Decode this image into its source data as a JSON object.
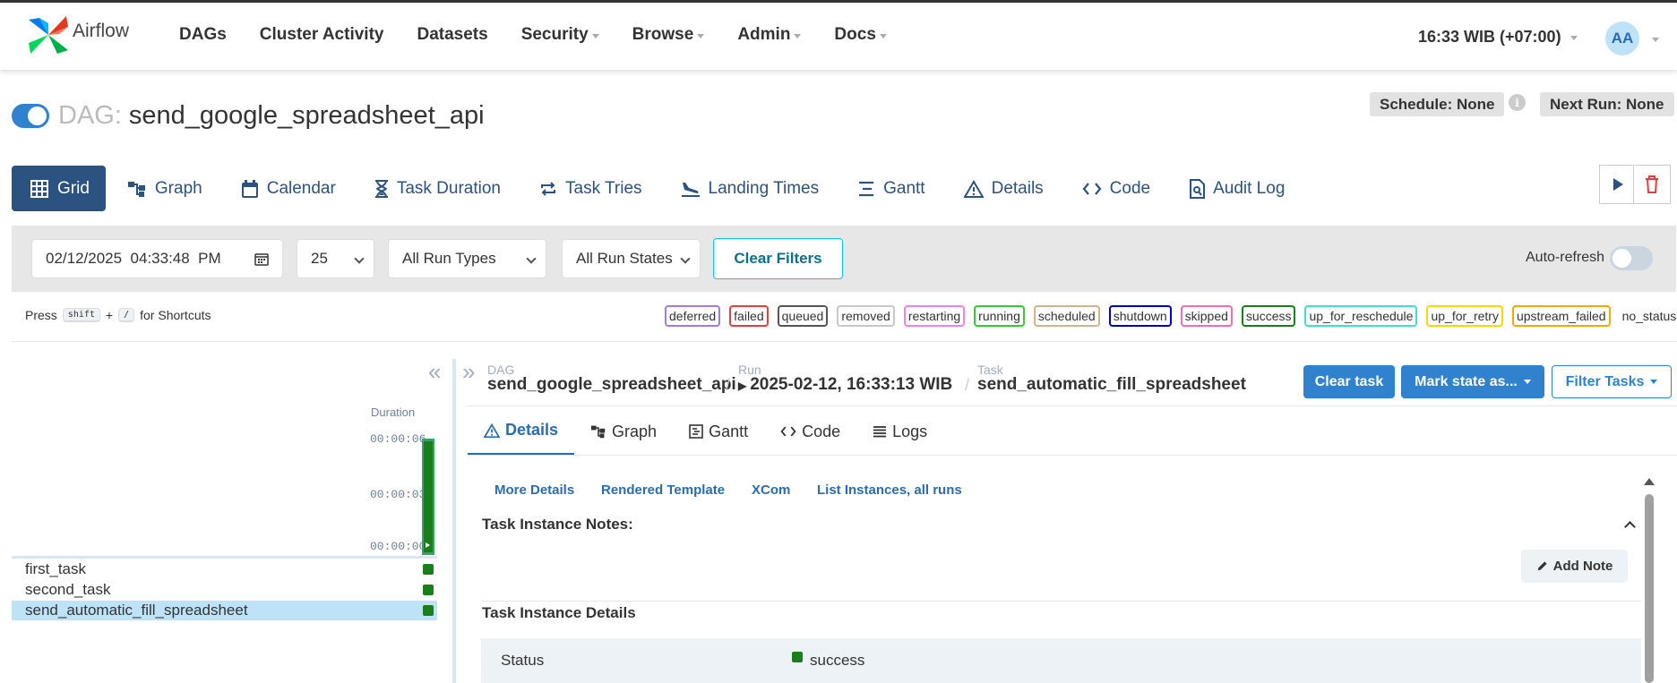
{
  "app": {
    "name": "Airflow"
  },
  "nav": {
    "items": [
      {
        "label": "DAGs",
        "caret": false
      },
      {
        "label": "Cluster Activity",
        "caret": false
      },
      {
        "label": "Datasets",
        "caret": false
      },
      {
        "label": "Security",
        "caret": true
      },
      {
        "label": "Browse",
        "caret": true
      },
      {
        "label": "Admin",
        "caret": true
      },
      {
        "label": "Docs",
        "caret": true
      }
    ],
    "timezone": "16:33 WIB (+07:00)",
    "avatar_initials": "AA"
  },
  "dag": {
    "label": "DAG:",
    "name": "send_google_spreadsheet_api",
    "schedule": "Schedule: None",
    "next_run": "Next Run: None",
    "info_icon": "i"
  },
  "view_tabs": [
    {
      "label": "Grid",
      "icon": "grid-icon"
    },
    {
      "label": "Graph",
      "icon": "graph-icon"
    },
    {
      "label": "Calendar",
      "icon": "calendar-icon"
    },
    {
      "label": "Task Duration",
      "icon": "hourglass-icon"
    },
    {
      "label": "Task Tries",
      "icon": "retry-icon"
    },
    {
      "label": "Landing Times",
      "icon": "landing-icon"
    },
    {
      "label": "Gantt",
      "icon": "gantt-icon"
    },
    {
      "label": "Details",
      "icon": "warning-triangle-icon"
    },
    {
      "label": "Code",
      "icon": "code-icon"
    },
    {
      "label": "Audit Log",
      "icon": "audit-log-icon"
    }
  ],
  "filters": {
    "date": "02/12/2025  04:33:48  PM",
    "num_runs": "25",
    "run_types": "All Run Types",
    "run_states": "All Run States",
    "clear_label": "Clear Filters",
    "auto_refresh_label": "Auto-refresh",
    "auto_refresh_on": false
  },
  "shortcuts": {
    "press": "Press",
    "key1": "shift",
    "plus": "+",
    "key2": "/",
    "suffix": "for Shortcuts"
  },
  "legend": [
    {
      "label": "deferred",
      "color": "#9f7aea"
    },
    {
      "label": "failed",
      "color": "#e53e3e"
    },
    {
      "label": "queued",
      "color": "#555555"
    },
    {
      "label": "removed",
      "color": "#c8c8c8"
    },
    {
      "label": "restarting",
      "color": "#ee82ee"
    },
    {
      "label": "running",
      "color": "#32cd32"
    },
    {
      "label": "scheduled",
      "color": "#d2b48c"
    },
    {
      "label": "shutdown",
      "color": "#0000cd"
    },
    {
      "label": "skipped",
      "color": "#ff69b4"
    },
    {
      "label": "success",
      "color": "#1a7f1a"
    },
    {
      "label": "up_for_reschedule",
      "color": "#40e0d0"
    },
    {
      "label": "up_for_retry",
      "color": "#ffd700"
    },
    {
      "label": "upstream_failed",
      "color": "#ffa500"
    },
    {
      "label": "no_status",
      "color": ""
    }
  ],
  "grid": {
    "duration_label": "Duration",
    "ticks": [
      "00:00:06",
      "00:00:03",
      "00:00:00"
    ],
    "run_duration_fraction": 1.0,
    "tasks": [
      {
        "name": "first_task",
        "state": "success"
      },
      {
        "name": "second_task",
        "state": "success"
      },
      {
        "name": "send_automatic_fill_spreadsheet",
        "state": "success"
      }
    ]
  },
  "breadcrumb": {
    "dag_small": "DAG",
    "dag_big": "send_google_spreadsheet_api",
    "run_small": "Run",
    "run_big": "2025-02-12, 16:33:13 WIB",
    "task_small": "Task",
    "task_big": "send_automatic_fill_spreadsheet"
  },
  "task_actions": {
    "clear": "Clear task",
    "mark_state": "Mark state as...",
    "filter": "Filter Tasks"
  },
  "detail_tabs": [
    {
      "label": "Details",
      "icon": "warning-triangle-icon"
    },
    {
      "label": "Graph",
      "icon": "graph-icon"
    },
    {
      "label": "Gantt",
      "icon": "gantt-icon"
    },
    {
      "label": "Code",
      "icon": "code-icon"
    },
    {
      "label": "Logs",
      "icon": "logs-icon"
    }
  ],
  "detail_links": [
    "More Details",
    "Rendered Template",
    "XCom",
    "List Instances, all runs"
  ],
  "notes": {
    "title": "Task Instance Notes:",
    "add_note": "Add Note"
  },
  "details": {
    "title": "Task Instance Details",
    "status_key": "Status",
    "status_value": "success"
  }
}
